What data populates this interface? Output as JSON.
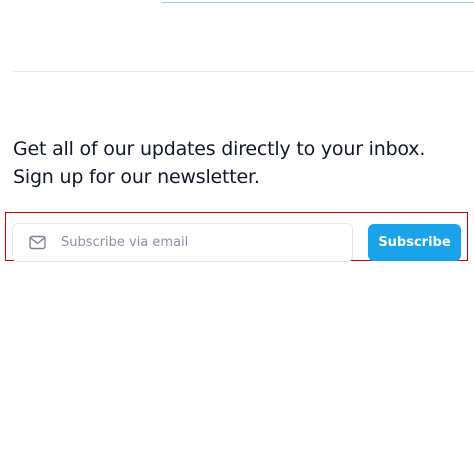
{
  "newsletter": {
    "headline_line1": "Get all of our updates directly to your inbox.",
    "headline_line2": "Sign up for our newsletter.",
    "email_placeholder": "Subscribe via email",
    "email_value": "",
    "subscribe_label": "Subscribe",
    "icon": "mail-icon"
  },
  "colors": {
    "accent": "#1ba3ea",
    "heading_text": "#111827",
    "placeholder_text": "#8b93a3",
    "highlight_outline": "#d40000"
  }
}
